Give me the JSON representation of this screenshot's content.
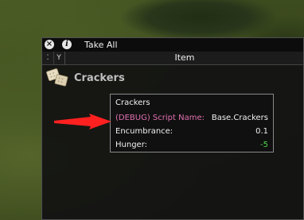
{
  "window": {
    "close_icon": "close-icon",
    "info_icon": "info-icon",
    "close_glyph": "×",
    "info_glyph": "i",
    "title": "Take All"
  },
  "header": {
    "sort_glyph": "⁚",
    "filter_glyph": "Y",
    "column_label": "Item"
  },
  "item": {
    "name": "Crackers",
    "icon": "crackers-icon"
  },
  "tooltip": {
    "title": "Crackers",
    "rows": [
      {
        "label": "(DEBUG) Script Name:",
        "value": "Base.Crackers",
        "label_color": "#e06fb0",
        "value_color": "#f0f0f0"
      },
      {
        "label": "Encumbrance:",
        "value": "0.1",
        "label_color": "#f0f0f0",
        "value_color": "#f0f0f0"
      },
      {
        "label": "Hunger:",
        "value": "-5",
        "label_color": "#f0f0f0",
        "value_color": "#4fd84a"
      }
    ]
  },
  "annotation": {
    "arrow_color": "#ff2020"
  }
}
